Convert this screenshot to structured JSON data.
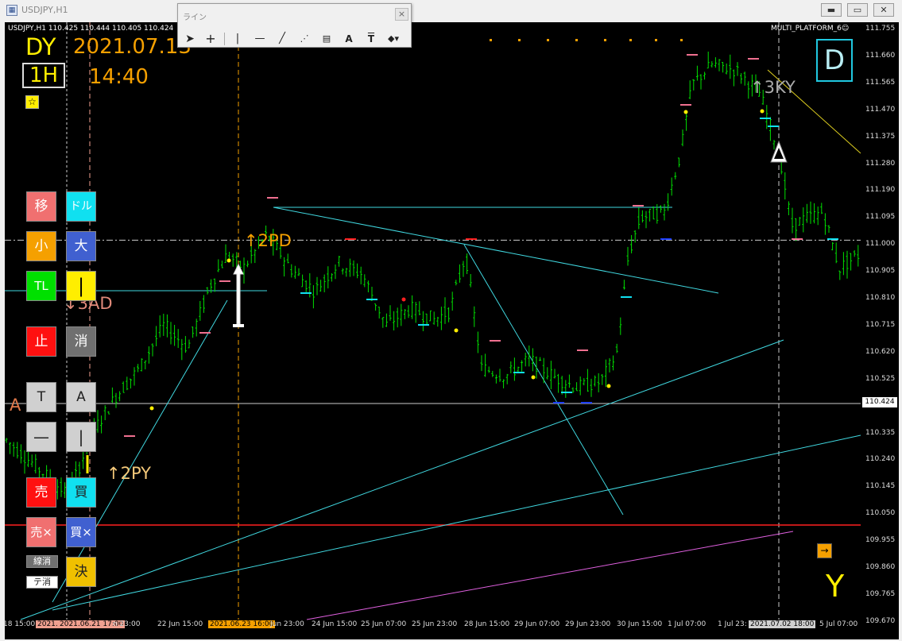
{
  "window": {
    "title": "USDJPY,H1",
    "minimize": "▬",
    "restore": "▭",
    "close": "✕"
  },
  "line_toolbar": {
    "title": "ライン",
    "close": "×",
    "tools": [
      "cursor-icon",
      "crosshair-icon",
      "vertical-line-icon",
      "horizontal-line-icon",
      "trendline-icon",
      "fibonacci-icon",
      "fibonacci-grid-icon",
      "text-icon",
      "label-icon",
      "shapes-dropdown-icon"
    ],
    "text_tool": "A",
    "label_tool": "T"
  },
  "chart_header": {
    "symbol_info": "USDJPY,H1  110.425 110.444 110.405 110.424",
    "indicator_label": "MULTI_PLATFORM_6☺"
  },
  "overlay": {
    "day_label": "DY",
    "date": "2021.07.13",
    "timeframe": "1H",
    "time": "14:40",
    "star": "☆",
    "d_box": "D",
    "y_label": "Y",
    "arrow_box": "→",
    "tags": {
      "pd": "↑2PD",
      "ad": "↓3AD",
      "py": "↑2PY",
      "ky": "↑3KY",
      "a": "A"
    }
  },
  "buttons": {
    "move": "移",
    "dollar": "ドル",
    "small": "小",
    "large": "大",
    "tl": "TL",
    "vline": "|",
    "stop": "止",
    "erase": "消",
    "text_t": "T",
    "text_a": "A",
    "hline": "—",
    "vline2": "|",
    "sell": "売",
    "buy": "買",
    "sell_x": "売×",
    "buy_x": "買×",
    "line_erase": "線消",
    "te_erase": "テ消",
    "settle": "決"
  },
  "price_axis": {
    "ticks": [
      "111.755",
      "111.660",
      "111.565",
      "111.470",
      "111.375",
      "111.280",
      "111.190",
      "111.095",
      "111.000",
      "110.905",
      "110.810",
      "110.715",
      "110.620",
      "110.525",
      "110.424",
      "110.335",
      "110.240",
      "110.145",
      "110.050",
      "109.955",
      "109.860",
      "109.765",
      "109.670"
    ],
    "current": "110.424"
  },
  "time_axis": {
    "labels": [
      "18 15:00",
      "2021.",
      "2021.06.21 17:00",
      "n 23:00",
      "22 Jun 15:00",
      "2021.06.23 16:00",
      "Jun 23:00",
      "24 Jun 15:00",
      "25 Jun 07:00",
      "25 Jun 23:00",
      "28 Jun 15:00",
      "29 Jun 07:00",
      "29 Jun 23:00",
      "30 Jun 15:00",
      "1 Jul 07:00",
      "1 Jul 23:",
      "2021.07.02 18:00",
      "5 Jul 07:00"
    ]
  },
  "colors": {
    "candle": "#00e000",
    "trendline": "#40d8e0",
    "red_line": "#ff2020",
    "magenta_line": "#e060e0",
    "orange_text": "#f5a000",
    "yellow_text": "#ffee00"
  }
}
